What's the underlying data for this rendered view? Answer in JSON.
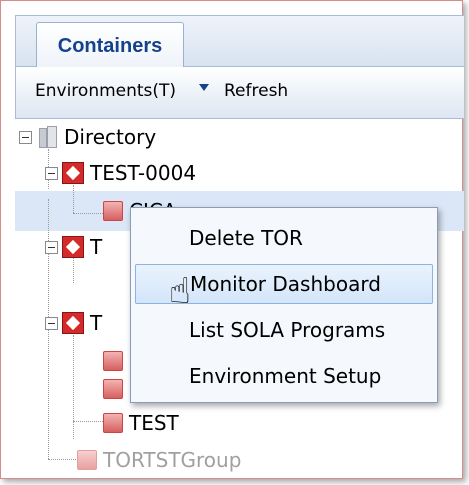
{
  "panel": {
    "tab_label": "Containers",
    "toolbar": {
      "environments_label": "Environments(T)",
      "refresh_label": "Refresh"
    }
  },
  "tree": {
    "root_label": "Directory",
    "nodes": [
      {
        "label": "TEST-0004"
      },
      {
        "label": "CICA"
      },
      {
        "label": "T"
      },
      {
        "label": "T"
      },
      {
        "label": "TEST"
      },
      {
        "label": "TORTSTGroup"
      }
    ]
  },
  "context_menu": {
    "items": [
      {
        "label": "Delete TOR"
      },
      {
        "label": "Monitor Dashboard"
      },
      {
        "label": "List SOLA Programs"
      },
      {
        "label": "Environment Setup"
      }
    ],
    "hovered_index": 1
  },
  "colors": {
    "tab_text": "#15428b",
    "node_icon": "#d52a2a",
    "selected_row": "#dbe7f6",
    "menu_hover": "#d3e5fa"
  },
  "icons": {
    "root": "directory-icon",
    "container": "red-box-icon",
    "leaf": "red-leaf-icon",
    "cursor": "hand-pointer-icon"
  }
}
